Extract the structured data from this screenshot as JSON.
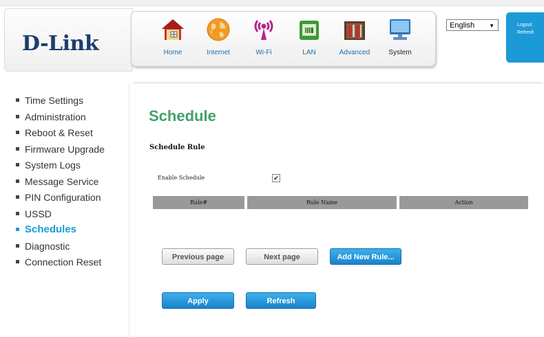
{
  "header": {
    "logo": "D-Link",
    "nav": [
      {
        "label": "Home",
        "icon": "home-icon"
      },
      {
        "label": "Internet",
        "icon": "globe-icon"
      },
      {
        "label": "Wi-Fi",
        "icon": "wifi-icon"
      },
      {
        "label": "LAN",
        "icon": "lan-icon"
      },
      {
        "label": "Advanced",
        "icon": "toolbox-icon"
      },
      {
        "label": "System",
        "icon": "computer-icon"
      }
    ],
    "language": "English",
    "logout": "Logout",
    "refresh": "Refresh"
  },
  "sidebar": {
    "items": [
      {
        "label": "Time Settings"
      },
      {
        "label": "Administration"
      },
      {
        "label": "Reboot & Reset"
      },
      {
        "label": "Firmware Upgrade"
      },
      {
        "label": "System Logs"
      },
      {
        "label": "Message Service"
      },
      {
        "label": "PIN Configuration"
      },
      {
        "label": "USSD"
      },
      {
        "label": "Schedules"
      },
      {
        "label": "Diagnostic"
      },
      {
        "label": "Connection Reset"
      }
    ],
    "active_index": 8
  },
  "main": {
    "title": "Schedule",
    "section_title": "Schedule Rule",
    "enable_label": "Enable Schedule",
    "enable_checked": true,
    "columns": [
      "Rule#",
      "Rule Name",
      "Action"
    ],
    "buttons": {
      "previous": "Previous page",
      "next": "Next page",
      "add": "Add New Rule...",
      "apply": "Apply",
      "refresh": "Refresh"
    }
  },
  "colors": {
    "accent": "#1c9ad7",
    "title_green": "#44a06b",
    "logo_navy": "#1d3e6c",
    "table_header": "#999999"
  }
}
